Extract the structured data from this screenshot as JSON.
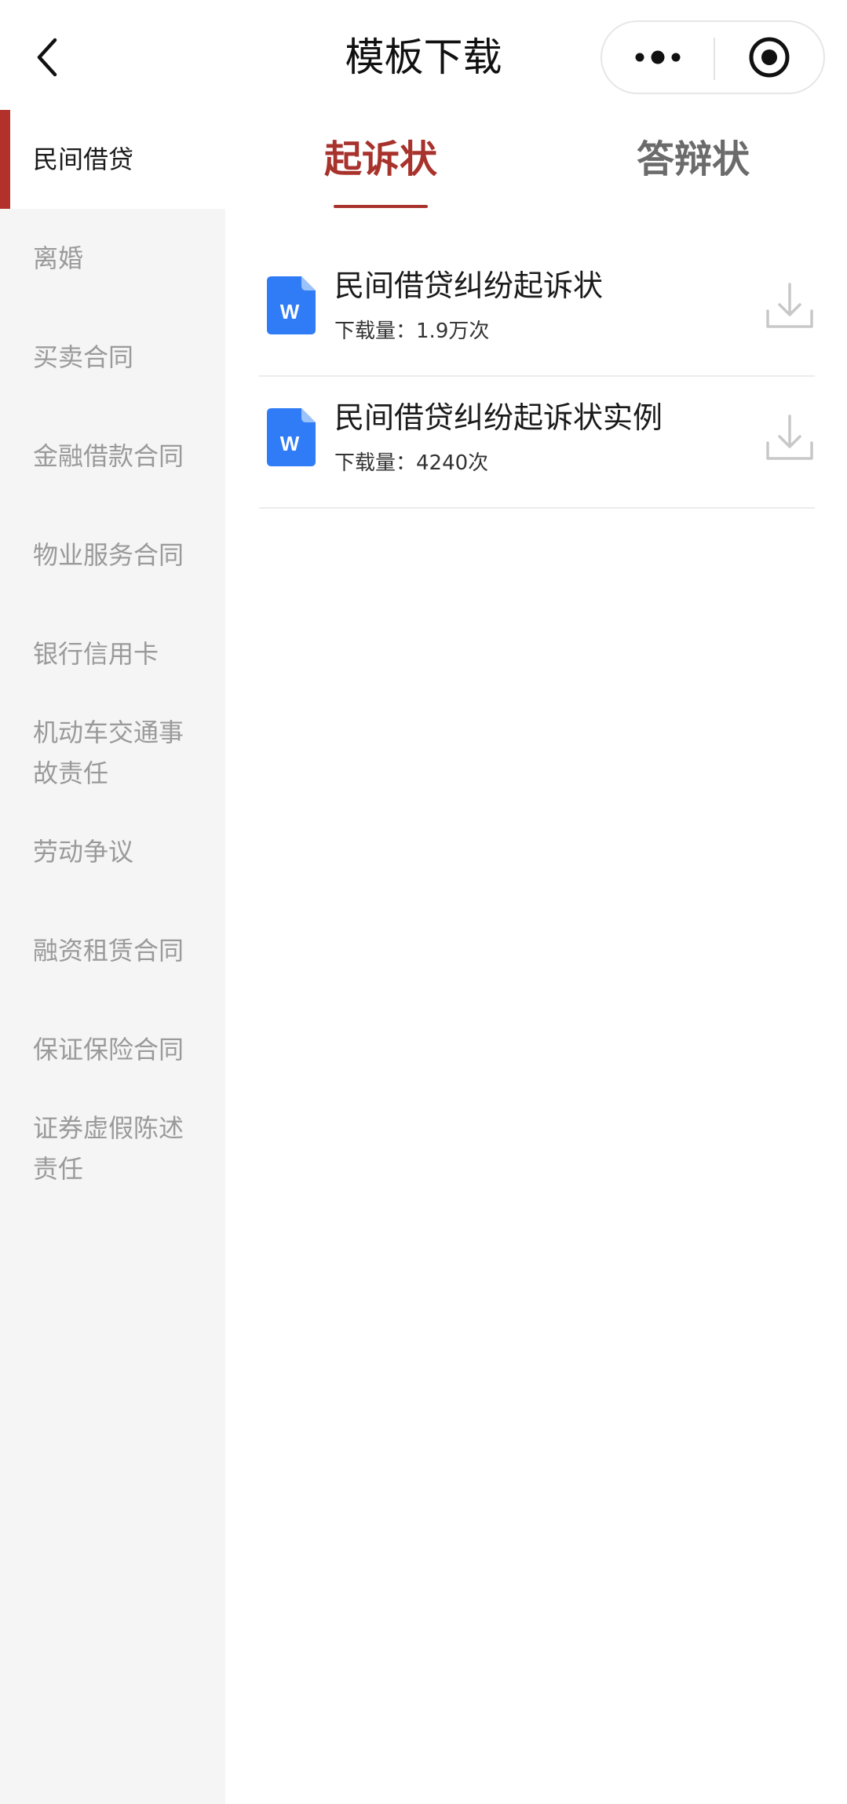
{
  "navbar": {
    "title": "模板下载",
    "back_icon": "chevron-left-icon",
    "more_icon": "more-dots-icon",
    "close_icon": "target-circle-icon"
  },
  "sidebar": {
    "items": [
      {
        "label": "民间借贷",
        "active": true
      },
      {
        "label": "离婚",
        "active": false
      },
      {
        "label": "买卖合同",
        "active": false
      },
      {
        "label": "金融借款合同",
        "active": false
      },
      {
        "label": "物业服务合同",
        "active": false
      },
      {
        "label": "银行信用卡",
        "active": false
      },
      {
        "label": "机动车交通事故责任",
        "active": false
      },
      {
        "label": "劳动争议",
        "active": false
      },
      {
        "label": "融资租赁合同",
        "active": false
      },
      {
        "label": "保证保险合同",
        "active": false
      },
      {
        "label": "证券虚假陈述责任",
        "active": false
      }
    ]
  },
  "tabs": [
    {
      "label": "起诉状",
      "active": true
    },
    {
      "label": "答辩状",
      "active": false
    }
  ],
  "templates": [
    {
      "title": "民间借贷纠纷起诉状",
      "downloads_label": "下载量：",
      "downloads": "1.9万次",
      "file_icon": "word-doc-icon",
      "action_icon": "download-icon"
    },
    {
      "title": "民间借贷纠纷起诉状实例",
      "downloads_label": "下载量：",
      "downloads": "4240次",
      "file_icon": "word-doc-icon",
      "action_icon": "download-icon"
    }
  ],
  "colors": {
    "accent": "#a8322c",
    "sidebar_bg": "#f5f5f5",
    "word_blue": "#2f7cf6",
    "inactive_text": "#9a9a9a"
  }
}
